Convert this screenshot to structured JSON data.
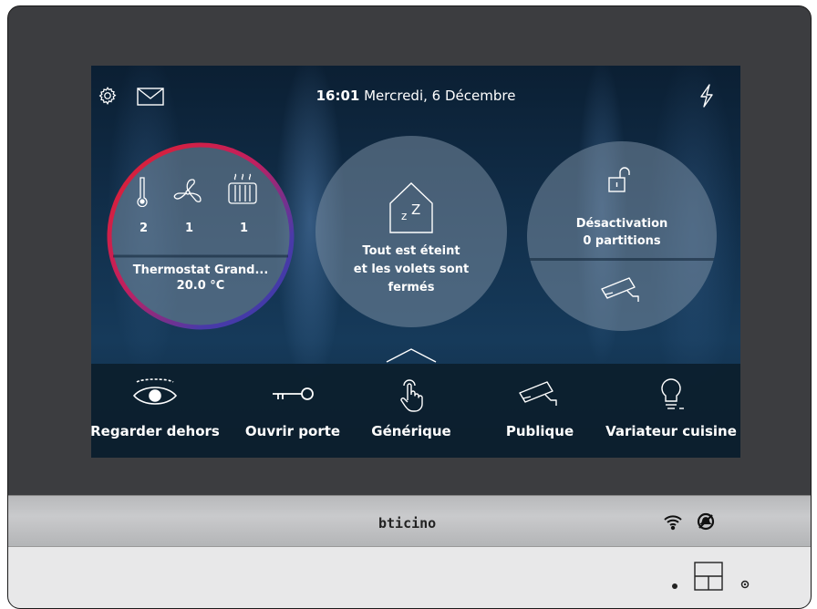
{
  "topbar": {
    "time": "16:01",
    "date": "Mercredi, 6 Décembre",
    "icons": [
      "gear-icon",
      "mail-icon",
      "lightning-icon"
    ]
  },
  "thermostat": {
    "counts": [
      "2",
      "1",
      "1"
    ],
    "name": "Thermostat Grand...",
    "temperature": "20.0 °C"
  },
  "scenario": {
    "line1": "Tout est éteint",
    "line2": "et les volets sont",
    "line3": "fermés"
  },
  "alarm": {
    "line1": "Désactivation",
    "line2": "0 partitions"
  },
  "bottom_items": [
    {
      "label": "Regarder dehors"
    },
    {
      "label": "Ouvrir porte"
    },
    {
      "label": "Générique"
    },
    {
      "label": "Publique"
    },
    {
      "label": "Variateur cuisine"
    }
  ],
  "brand": "bticino",
  "colors": {
    "arc_red": "#e0202e",
    "arc_blue": "#3a3aa8"
  }
}
